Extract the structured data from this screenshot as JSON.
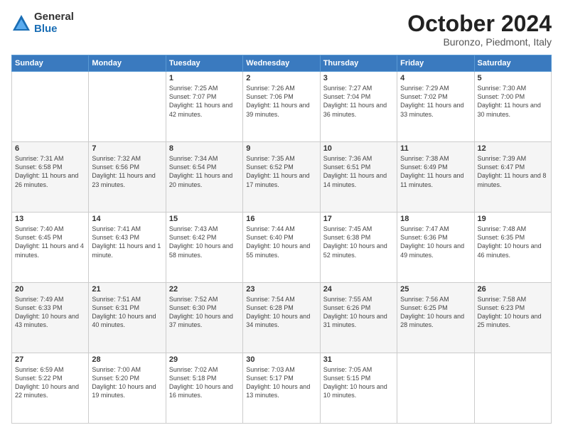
{
  "header": {
    "logo_general": "General",
    "logo_blue": "Blue",
    "month_title": "October 2024",
    "location": "Buronzo, Piedmont, Italy"
  },
  "days_of_week": [
    "Sunday",
    "Monday",
    "Tuesday",
    "Wednesday",
    "Thursday",
    "Friday",
    "Saturday"
  ],
  "weeks": [
    [
      {
        "day": "",
        "info": ""
      },
      {
        "day": "",
        "info": ""
      },
      {
        "day": "1",
        "info": "Sunrise: 7:25 AM\nSunset: 7:07 PM\nDaylight: 11 hours and 42 minutes."
      },
      {
        "day": "2",
        "info": "Sunrise: 7:26 AM\nSunset: 7:06 PM\nDaylight: 11 hours and 39 minutes."
      },
      {
        "day": "3",
        "info": "Sunrise: 7:27 AM\nSunset: 7:04 PM\nDaylight: 11 hours and 36 minutes."
      },
      {
        "day": "4",
        "info": "Sunrise: 7:29 AM\nSunset: 7:02 PM\nDaylight: 11 hours and 33 minutes."
      },
      {
        "day": "5",
        "info": "Sunrise: 7:30 AM\nSunset: 7:00 PM\nDaylight: 11 hours and 30 minutes."
      }
    ],
    [
      {
        "day": "6",
        "info": "Sunrise: 7:31 AM\nSunset: 6:58 PM\nDaylight: 11 hours and 26 minutes."
      },
      {
        "day": "7",
        "info": "Sunrise: 7:32 AM\nSunset: 6:56 PM\nDaylight: 11 hours and 23 minutes."
      },
      {
        "day": "8",
        "info": "Sunrise: 7:34 AM\nSunset: 6:54 PM\nDaylight: 11 hours and 20 minutes."
      },
      {
        "day": "9",
        "info": "Sunrise: 7:35 AM\nSunset: 6:52 PM\nDaylight: 11 hours and 17 minutes."
      },
      {
        "day": "10",
        "info": "Sunrise: 7:36 AM\nSunset: 6:51 PM\nDaylight: 11 hours and 14 minutes."
      },
      {
        "day": "11",
        "info": "Sunrise: 7:38 AM\nSunset: 6:49 PM\nDaylight: 11 hours and 11 minutes."
      },
      {
        "day": "12",
        "info": "Sunrise: 7:39 AM\nSunset: 6:47 PM\nDaylight: 11 hours and 8 minutes."
      }
    ],
    [
      {
        "day": "13",
        "info": "Sunrise: 7:40 AM\nSunset: 6:45 PM\nDaylight: 11 hours and 4 minutes."
      },
      {
        "day": "14",
        "info": "Sunrise: 7:41 AM\nSunset: 6:43 PM\nDaylight: 11 hours and 1 minute."
      },
      {
        "day": "15",
        "info": "Sunrise: 7:43 AM\nSunset: 6:42 PM\nDaylight: 10 hours and 58 minutes."
      },
      {
        "day": "16",
        "info": "Sunrise: 7:44 AM\nSunset: 6:40 PM\nDaylight: 10 hours and 55 minutes."
      },
      {
        "day": "17",
        "info": "Sunrise: 7:45 AM\nSunset: 6:38 PM\nDaylight: 10 hours and 52 minutes."
      },
      {
        "day": "18",
        "info": "Sunrise: 7:47 AM\nSunset: 6:36 PM\nDaylight: 10 hours and 49 minutes."
      },
      {
        "day": "19",
        "info": "Sunrise: 7:48 AM\nSunset: 6:35 PM\nDaylight: 10 hours and 46 minutes."
      }
    ],
    [
      {
        "day": "20",
        "info": "Sunrise: 7:49 AM\nSunset: 6:33 PM\nDaylight: 10 hours and 43 minutes."
      },
      {
        "day": "21",
        "info": "Sunrise: 7:51 AM\nSunset: 6:31 PM\nDaylight: 10 hours and 40 minutes."
      },
      {
        "day": "22",
        "info": "Sunrise: 7:52 AM\nSunset: 6:30 PM\nDaylight: 10 hours and 37 minutes."
      },
      {
        "day": "23",
        "info": "Sunrise: 7:54 AM\nSunset: 6:28 PM\nDaylight: 10 hours and 34 minutes."
      },
      {
        "day": "24",
        "info": "Sunrise: 7:55 AM\nSunset: 6:26 PM\nDaylight: 10 hours and 31 minutes."
      },
      {
        "day": "25",
        "info": "Sunrise: 7:56 AM\nSunset: 6:25 PM\nDaylight: 10 hours and 28 minutes."
      },
      {
        "day": "26",
        "info": "Sunrise: 7:58 AM\nSunset: 6:23 PM\nDaylight: 10 hours and 25 minutes."
      }
    ],
    [
      {
        "day": "27",
        "info": "Sunrise: 6:59 AM\nSunset: 5:22 PM\nDaylight: 10 hours and 22 minutes."
      },
      {
        "day": "28",
        "info": "Sunrise: 7:00 AM\nSunset: 5:20 PM\nDaylight: 10 hours and 19 minutes."
      },
      {
        "day": "29",
        "info": "Sunrise: 7:02 AM\nSunset: 5:18 PM\nDaylight: 10 hours and 16 minutes."
      },
      {
        "day": "30",
        "info": "Sunrise: 7:03 AM\nSunset: 5:17 PM\nDaylight: 10 hours and 13 minutes."
      },
      {
        "day": "31",
        "info": "Sunrise: 7:05 AM\nSunset: 5:15 PM\nDaylight: 10 hours and 10 minutes."
      },
      {
        "day": "",
        "info": ""
      },
      {
        "day": "",
        "info": ""
      }
    ]
  ]
}
